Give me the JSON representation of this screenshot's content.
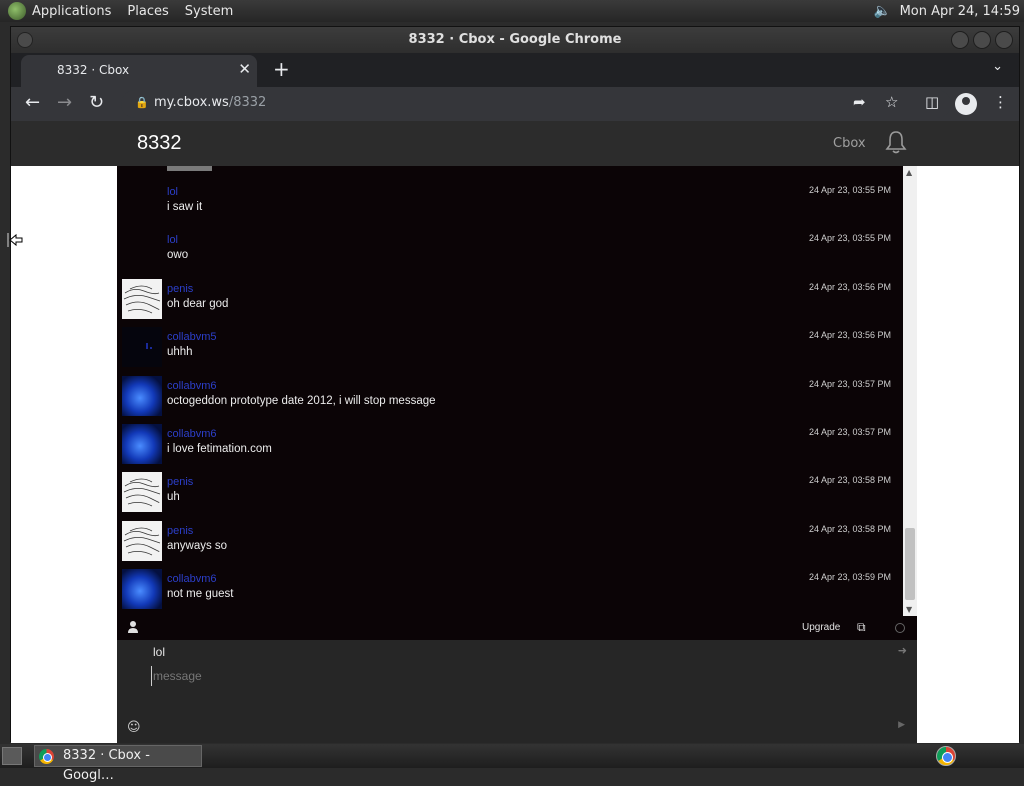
{
  "top_panel": {
    "menus": [
      "Applications",
      "Places",
      "System"
    ],
    "clock": "Mon Apr 24, 14:59"
  },
  "window": {
    "title": "8332 · Cbox - Google Chrome"
  },
  "browser": {
    "tab_title": "8332 · Cbox",
    "url_host": "my.cbox.ws",
    "url_path": "/8332"
  },
  "app": {
    "room_name": "8332",
    "brand": "Cbox"
  },
  "messages": [
    {
      "user": "lol",
      "text": "i saw it",
      "time": "24 Apr 23, 03:55 PM",
      "avatar": "none"
    },
    {
      "user": "lol",
      "text": "owo",
      "time": "24 Apr 23, 03:55 PM",
      "avatar": "none"
    },
    {
      "user": "penis",
      "text": "oh dear god",
      "time": "24 Apr 23, 03:56 PM",
      "avatar": "sketch"
    },
    {
      "user": "collabvm5",
      "text": "uhhh",
      "time": "24 Apr 23, 03:56 PM",
      "avatar": "dark"
    },
    {
      "user": "collabvm6",
      "text": "octogeddon prototype date 2012, i will stop message",
      "time": "24 Apr 23, 03:57 PM",
      "avatar": "blue"
    },
    {
      "user": "collabvm6",
      "text": "i love fetimation.com",
      "time": "24 Apr 23, 03:57 PM",
      "avatar": "blue"
    },
    {
      "user": "penis",
      "text": "uh",
      "time": "24 Apr 23, 03:58 PM",
      "avatar": "sketch"
    },
    {
      "user": "penis",
      "text": "anyways so",
      "time": "24 Apr 23, 03:58 PM",
      "avatar": "sketch"
    },
    {
      "user": "collabvm6",
      "text": "not me guest",
      "time": "24 Apr 23, 03:59 PM",
      "avatar": "blue"
    }
  ],
  "statusbar": {
    "upgrade_label": "Upgrade"
  },
  "composer": {
    "name": "lol",
    "placeholder": "message"
  },
  "taskbar": {
    "item_label": "8332 · Cbox - Googl…"
  }
}
